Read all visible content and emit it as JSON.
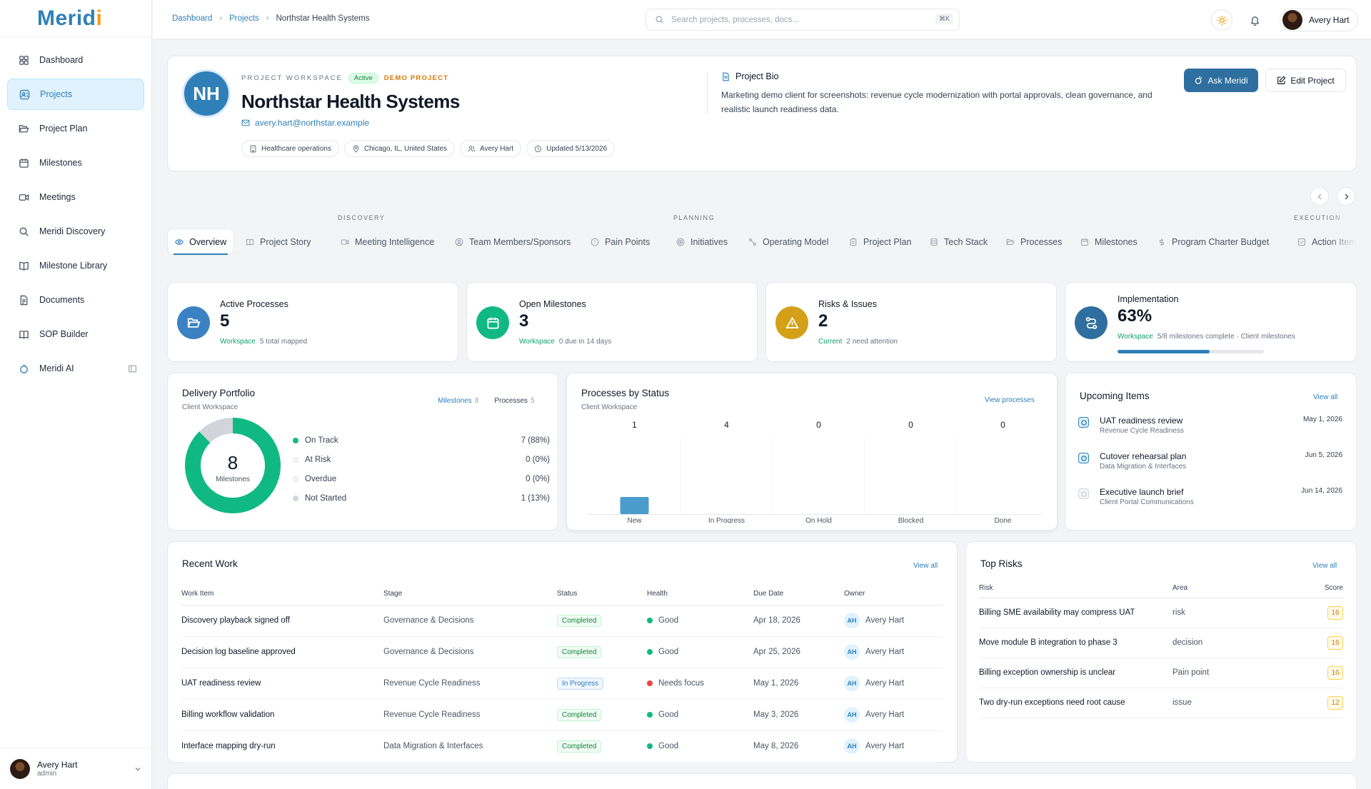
{
  "brand": {
    "name": "Meridi"
  },
  "sidebar": {
    "items": [
      {
        "label": "Dashboard"
      },
      {
        "label": "Projects"
      },
      {
        "label": "Project Plan"
      },
      {
        "label": "Milestones"
      },
      {
        "label": "Meetings"
      },
      {
        "label": "Meridi Discovery"
      },
      {
        "label": "Milestone Library"
      },
      {
        "label": "Documents"
      },
      {
        "label": "SOP Builder"
      },
      {
        "label": "Meridi AI"
      }
    ],
    "user": {
      "name": "Avery Hart",
      "role": "admin"
    }
  },
  "topbar": {
    "breadcrumbs": [
      "Dashboard",
      "Projects",
      "Northstar Health Systems"
    ],
    "search_placeholder": "Search projects, processes, docs...",
    "search_shortcut": "⌘K",
    "user_name": "Avery Hart"
  },
  "project": {
    "initials": "NH",
    "eyebrow": "PROJECT WORKSPACE",
    "status": "Active",
    "demo_label": "DEMO PROJECT",
    "name": "Northstar Health Systems",
    "email": "avery.hart@northstar.example",
    "chips": [
      "Healthcare operations",
      "Chicago, IL, United States",
      "Avery Hart",
      "Updated 5/13/2026"
    ],
    "bio_title": "Project Bio",
    "bio": "Marketing demo client for screenshots: revenue cycle modernization with portal approvals, clean governance, and realistic launch readiness data.",
    "ask_label": "Ask Meridi",
    "edit_label": "Edit Project"
  },
  "tabs": {
    "groups": [
      "DISCOVERY",
      "PLANNING",
      "EXECUTION"
    ],
    "items": [
      {
        "label": "Overview",
        "icon": "eye-icon"
      },
      {
        "label": "Project Story",
        "icon": "book-icon"
      },
      {
        "label": "Meeting Intelligence",
        "icon": "video-icon"
      },
      {
        "label": "Team Members/Sponsors",
        "icon": "users-icon"
      },
      {
        "label": "Pain Points",
        "icon": "alert-icon"
      },
      {
        "label": "Initiatives",
        "icon": "target-icon"
      },
      {
        "label": "Operating Model",
        "icon": "workflow-icon"
      },
      {
        "label": "Project Plan",
        "icon": "clipboard-icon"
      },
      {
        "label": "Tech Stack",
        "icon": "database-icon"
      },
      {
        "label": "Processes",
        "icon": "folder-icon"
      },
      {
        "label": "Milestones",
        "icon": "calendar-icon"
      },
      {
        "label": "Program Charter Budget",
        "icon": "dollar-icon"
      },
      {
        "label": "Action Items",
        "icon": "check-square-icon"
      }
    ]
  },
  "kpis": [
    {
      "label": "Active Processes",
      "value": "5",
      "tag": "Workspace",
      "sub": "5 total mapped",
      "color": "#3b82c4"
    },
    {
      "label": "Open Milestones",
      "value": "3",
      "tag": "Workspace",
      "sub": "0 due in 14 days",
      "color": "#10b981"
    },
    {
      "label": "Risks & Issues",
      "value": "2",
      "tag": "Current",
      "sub": "2 need attention",
      "color": "#d4a017"
    },
    {
      "label": "Implementation",
      "value": "63%",
      "tag": "Workspace",
      "sub": "5/8 milestones complete · Client milestones",
      "color": "#2f6f9f",
      "progress": 0.63
    }
  ],
  "portfolio": {
    "title": "Delivery Portfolio",
    "subtitle": "Client Workspace",
    "tab_milestones": "Milestones",
    "tab_milestones_count": "8",
    "tab_processes": "Processes",
    "tab_processes_count": "5",
    "total": "8",
    "total_label": "Milestones",
    "legend": [
      {
        "label": "On Track",
        "value": "7 (88%)",
        "color": "#10b981",
        "fraction": 0.875
      },
      {
        "label": "At Risk",
        "value": "0 (0%)",
        "color": "#f3f4f6",
        "fraction": 0
      },
      {
        "label": "Overdue",
        "value": "0 (0%)",
        "color": "#f3f4f6",
        "fraction": 0
      },
      {
        "label": "Not Started",
        "value": "1 (13%)",
        "color": "#d1d5db",
        "fraction": 0.125
      }
    ]
  },
  "chart_data": {
    "type": "bar",
    "title": "Processes by Status",
    "subtitle": "Client Workspace",
    "categories": [
      "New",
      "In Progress",
      "On Hold",
      "Blocked",
      "Done"
    ],
    "values": [
      1,
      4,
      0,
      0,
      0
    ],
    "visible_bar_heights_relative": [
      1,
      0,
      0,
      0,
      0
    ],
    "bar_color": "#4a9ccc"
  },
  "processes_link": "View processes",
  "upcoming": {
    "title": "Upcoming Items",
    "link": "View all",
    "items": [
      {
        "title": "UAT readiness review",
        "sub": "Revenue Cycle Readiness",
        "date": "May 1, 2026",
        "state": "active"
      },
      {
        "title": "Cutover rehearsal plan",
        "sub": "Data Migration & Interfaces",
        "date": "Jun 5, 2026",
        "state": "active"
      },
      {
        "title": "Executive launch brief",
        "sub": "Client Portal Communications",
        "date": "Jun 14, 2026",
        "state": "pending"
      }
    ]
  },
  "recent_work": {
    "title": "Recent Work",
    "link": "View all",
    "columns": [
      "Work Item",
      "Stage",
      "Status",
      "Health",
      "Due Date",
      "Owner"
    ],
    "rows": [
      {
        "item": "Discovery playback signed off",
        "stage": "Governance & Decisions",
        "status": "Completed",
        "health": "Good",
        "due": "Apr 18, 2026",
        "owner_initials": "AH",
        "owner": "Avery Hart"
      },
      {
        "item": "Decision log baseline approved",
        "stage": "Governance & Decisions",
        "status": "Completed",
        "health": "Good",
        "due": "Apr 25, 2026",
        "owner_initials": "AH",
        "owner": "Avery Hart"
      },
      {
        "item": "UAT readiness review",
        "stage": "Revenue Cycle Readiness",
        "status": "In Progress",
        "health": "Needs focus",
        "due": "May 1, 2026",
        "owner_initials": "AH",
        "owner": "Avery Hart"
      },
      {
        "item": "Billing workflow validation",
        "stage": "Revenue Cycle Readiness",
        "status": "Completed",
        "health": "Good",
        "due": "May 3, 2026",
        "owner_initials": "AH",
        "owner": "Avery Hart"
      },
      {
        "item": "Interface mapping dry-run",
        "stage": "Data Migration & Interfaces",
        "status": "Completed",
        "health": "Good",
        "due": "May 8, 2026",
        "owner_initials": "AH",
        "owner": "Avery Hart"
      }
    ]
  },
  "top_risks": {
    "title": "Top Risks",
    "link": "View all",
    "columns": [
      "Risk",
      "Area",
      "Score"
    ],
    "rows": [
      {
        "risk": "Billing SME availability may compress UAT",
        "area": "risk",
        "score": "16"
      },
      {
        "risk": "Move module B integration to phase 3",
        "area": "decision",
        "score": "16"
      },
      {
        "risk": "Billing exception ownership is unclear",
        "area": "Pain point",
        "score": "16"
      },
      {
        "risk": "Two dry-run exceptions need root cause",
        "area": "issue",
        "score": "12"
      }
    ]
  }
}
